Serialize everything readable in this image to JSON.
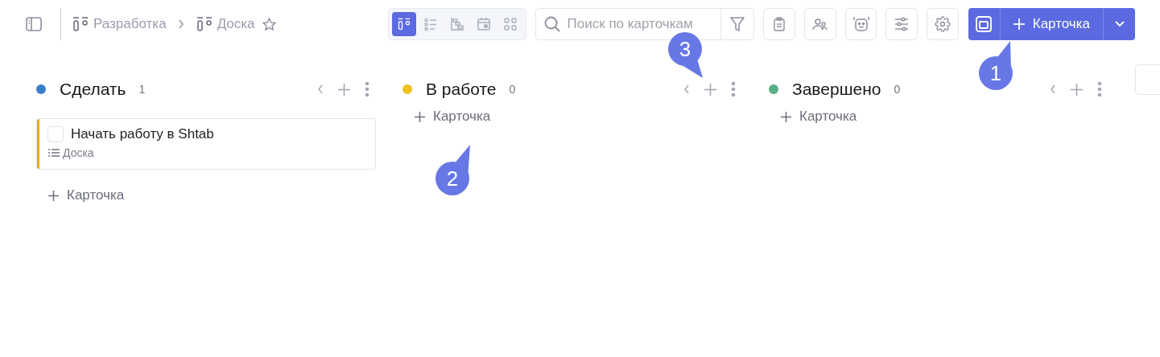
{
  "breadcrumb": [
    {
      "label": "Разработка"
    },
    {
      "label": "Доска"
    }
  ],
  "starred": false,
  "view_switcher": [
    {
      "kind": "board",
      "selected": true
    },
    {
      "kind": "list",
      "selected": false
    },
    {
      "kind": "gantt",
      "selected": false
    },
    {
      "kind": "calendar",
      "selected": false
    },
    {
      "kind": "grid",
      "selected": false
    }
  ],
  "search": {
    "placeholder": "Поиск по карточкам"
  },
  "add_button": {
    "label": "Карточка"
  },
  "columns": [
    {
      "title": "Сделать",
      "count": "1",
      "color": "#3a7fc8",
      "add_label": "Карточка",
      "cards": [
        {
          "title": "Начать работу в Shtab",
          "done": false,
          "board": "Доска",
          "color": "#e0aa2e"
        }
      ]
    },
    {
      "title": "В работе",
      "count": "0",
      "color": "#eec21f",
      "add_label": "Карточка"
    },
    {
      "title": "Завершено",
      "count": "0",
      "color": "#5aae85",
      "add_label": "Карточка"
    }
  ],
  "callouts": [
    {
      "label": "1"
    },
    {
      "label": "2"
    },
    {
      "label": "3"
    }
  ]
}
